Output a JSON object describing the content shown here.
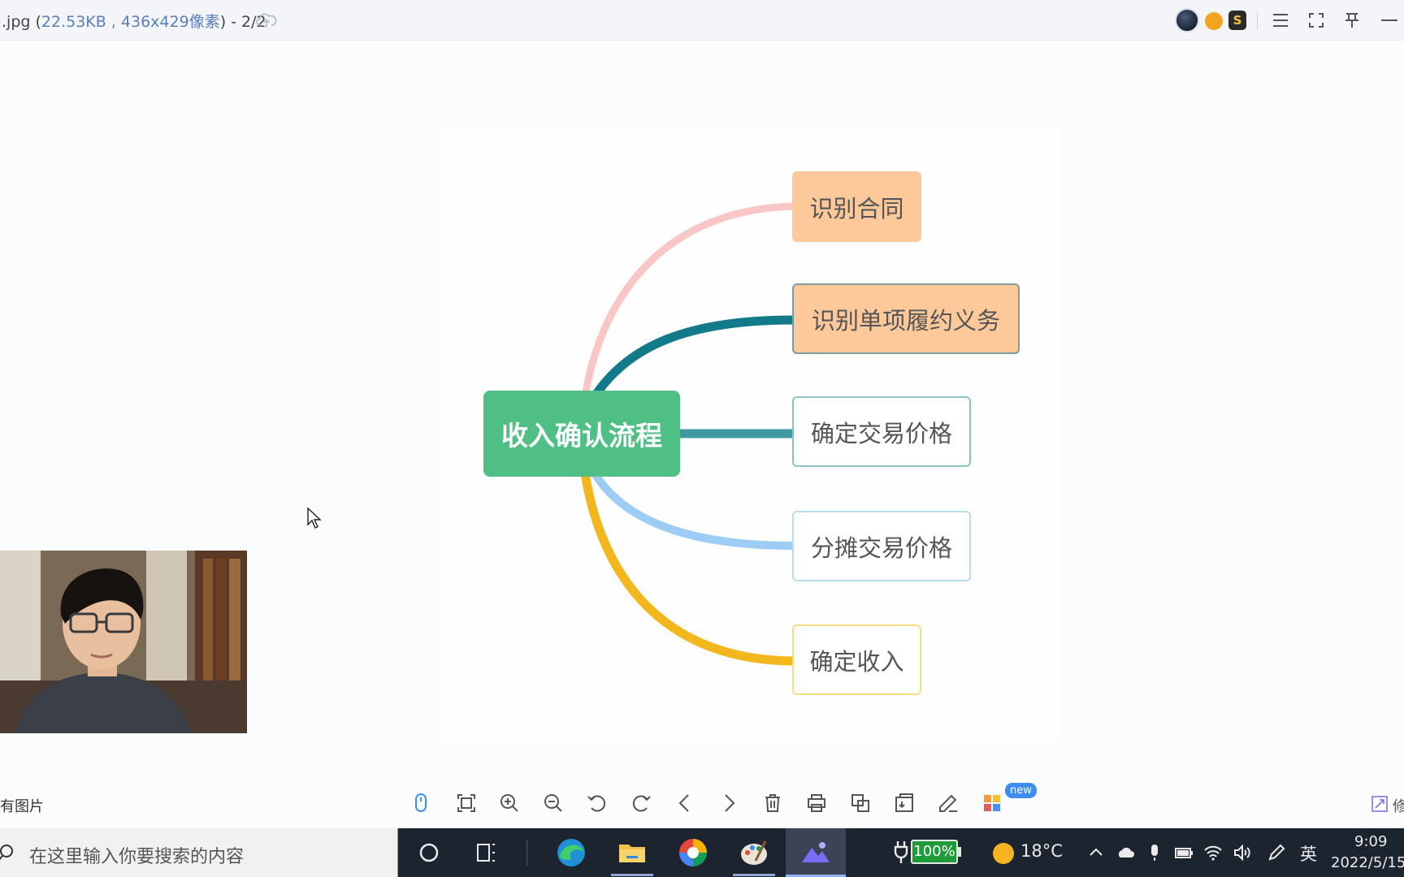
{
  "titlebar": {
    "filename": ".jpg (",
    "size": "22.53KB",
    "sep": " , ",
    "dims": "436x429像素",
    "suffix": ") - 2/2"
  },
  "mindmap": {
    "root": "收入确认流程",
    "branches": [
      {
        "label": "识别合同",
        "color": "#f9c6c6"
      },
      {
        "label": "识别单项履约义务",
        "color": "#137a8a"
      },
      {
        "label": "确定交易价格",
        "color": "#3f9aa4"
      },
      {
        "label": "分摊交易价格",
        "color": "#9dcdf4"
      },
      {
        "label": "确定收入",
        "color": "#f1b71d"
      }
    ]
  },
  "toolbar": {
    "left_label": "有图片",
    "tools": [
      "mouse-mode-icon",
      "fit-window-icon",
      "zoom-in-icon",
      "zoom-out-icon",
      "rotate-left-icon",
      "rotate-right-icon",
      "previous-icon",
      "next-icon",
      "delete-icon",
      "print-icon",
      "convert-icon",
      "compress-icon",
      "edit-icon",
      "apps-icon"
    ],
    "new_badge": "new",
    "right_label": "修"
  },
  "taskbar": {
    "search_placeholder": "在这里输入你要搜索的内容",
    "battery": "100%",
    "temperature": "18°C",
    "ime": "英",
    "time": "9:09",
    "date": "2022/5/15"
  },
  "colors": {
    "root_green": "#4fbf86",
    "accent_blue": "#3d8ef0"
  }
}
